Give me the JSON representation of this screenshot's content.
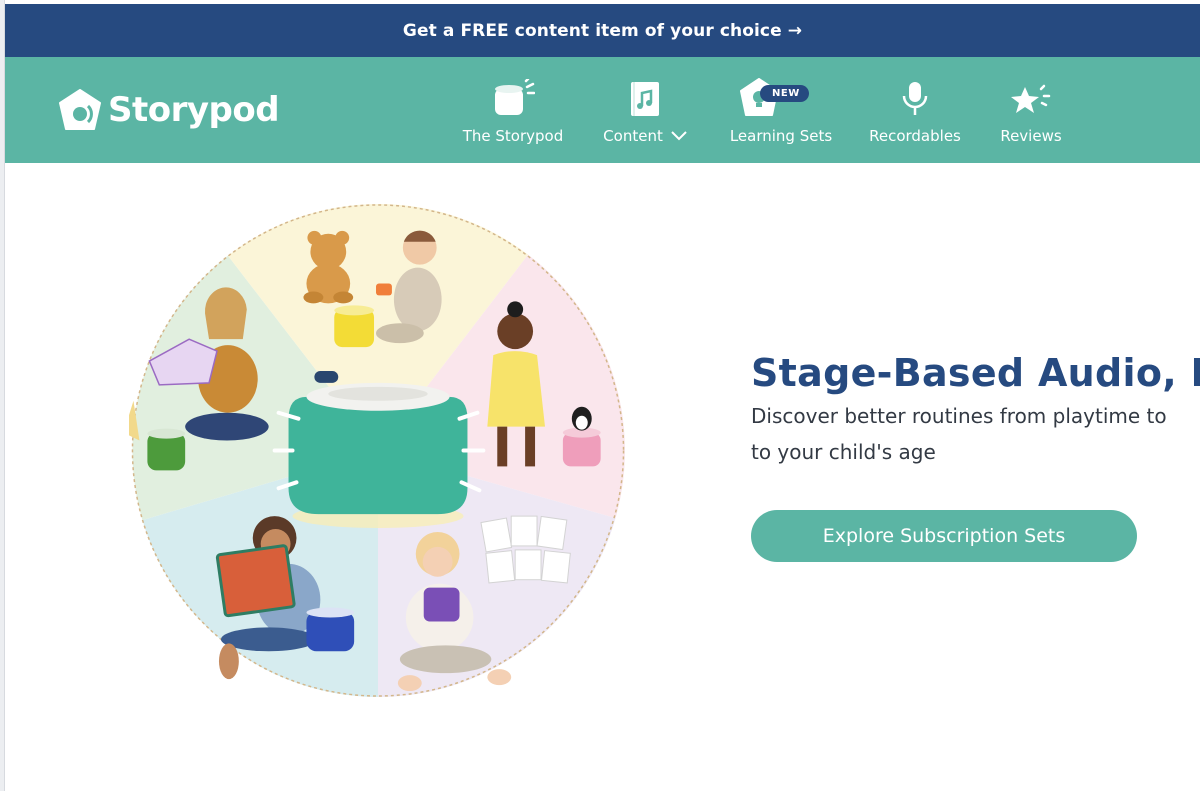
{
  "promo": {
    "text": "Get a FREE content item of your choice",
    "arrow": "→"
  },
  "brand": {
    "name": "Storypod",
    "teal": "#5bb5a4",
    "navy": "#264a80"
  },
  "nav": {
    "items": [
      {
        "label": "The Storypod",
        "icon": "storypod-speaker-icon"
      },
      {
        "label": "Content",
        "icon": "music-book-icon",
        "has_dropdown": true
      },
      {
        "label": "Learning Sets",
        "icon": "lightbulb-icon",
        "badge": "NEW"
      },
      {
        "label": "Recordables",
        "icon": "microphone-icon"
      },
      {
        "label": "Reviews",
        "icon": "star-icon"
      }
    ]
  },
  "hero": {
    "heading": "Stage-Based Audio, De",
    "subtext_line1": "Discover better routines from playtime to",
    "subtext_line2": "to your child's age",
    "cta": "Explore Subscription Sets"
  }
}
